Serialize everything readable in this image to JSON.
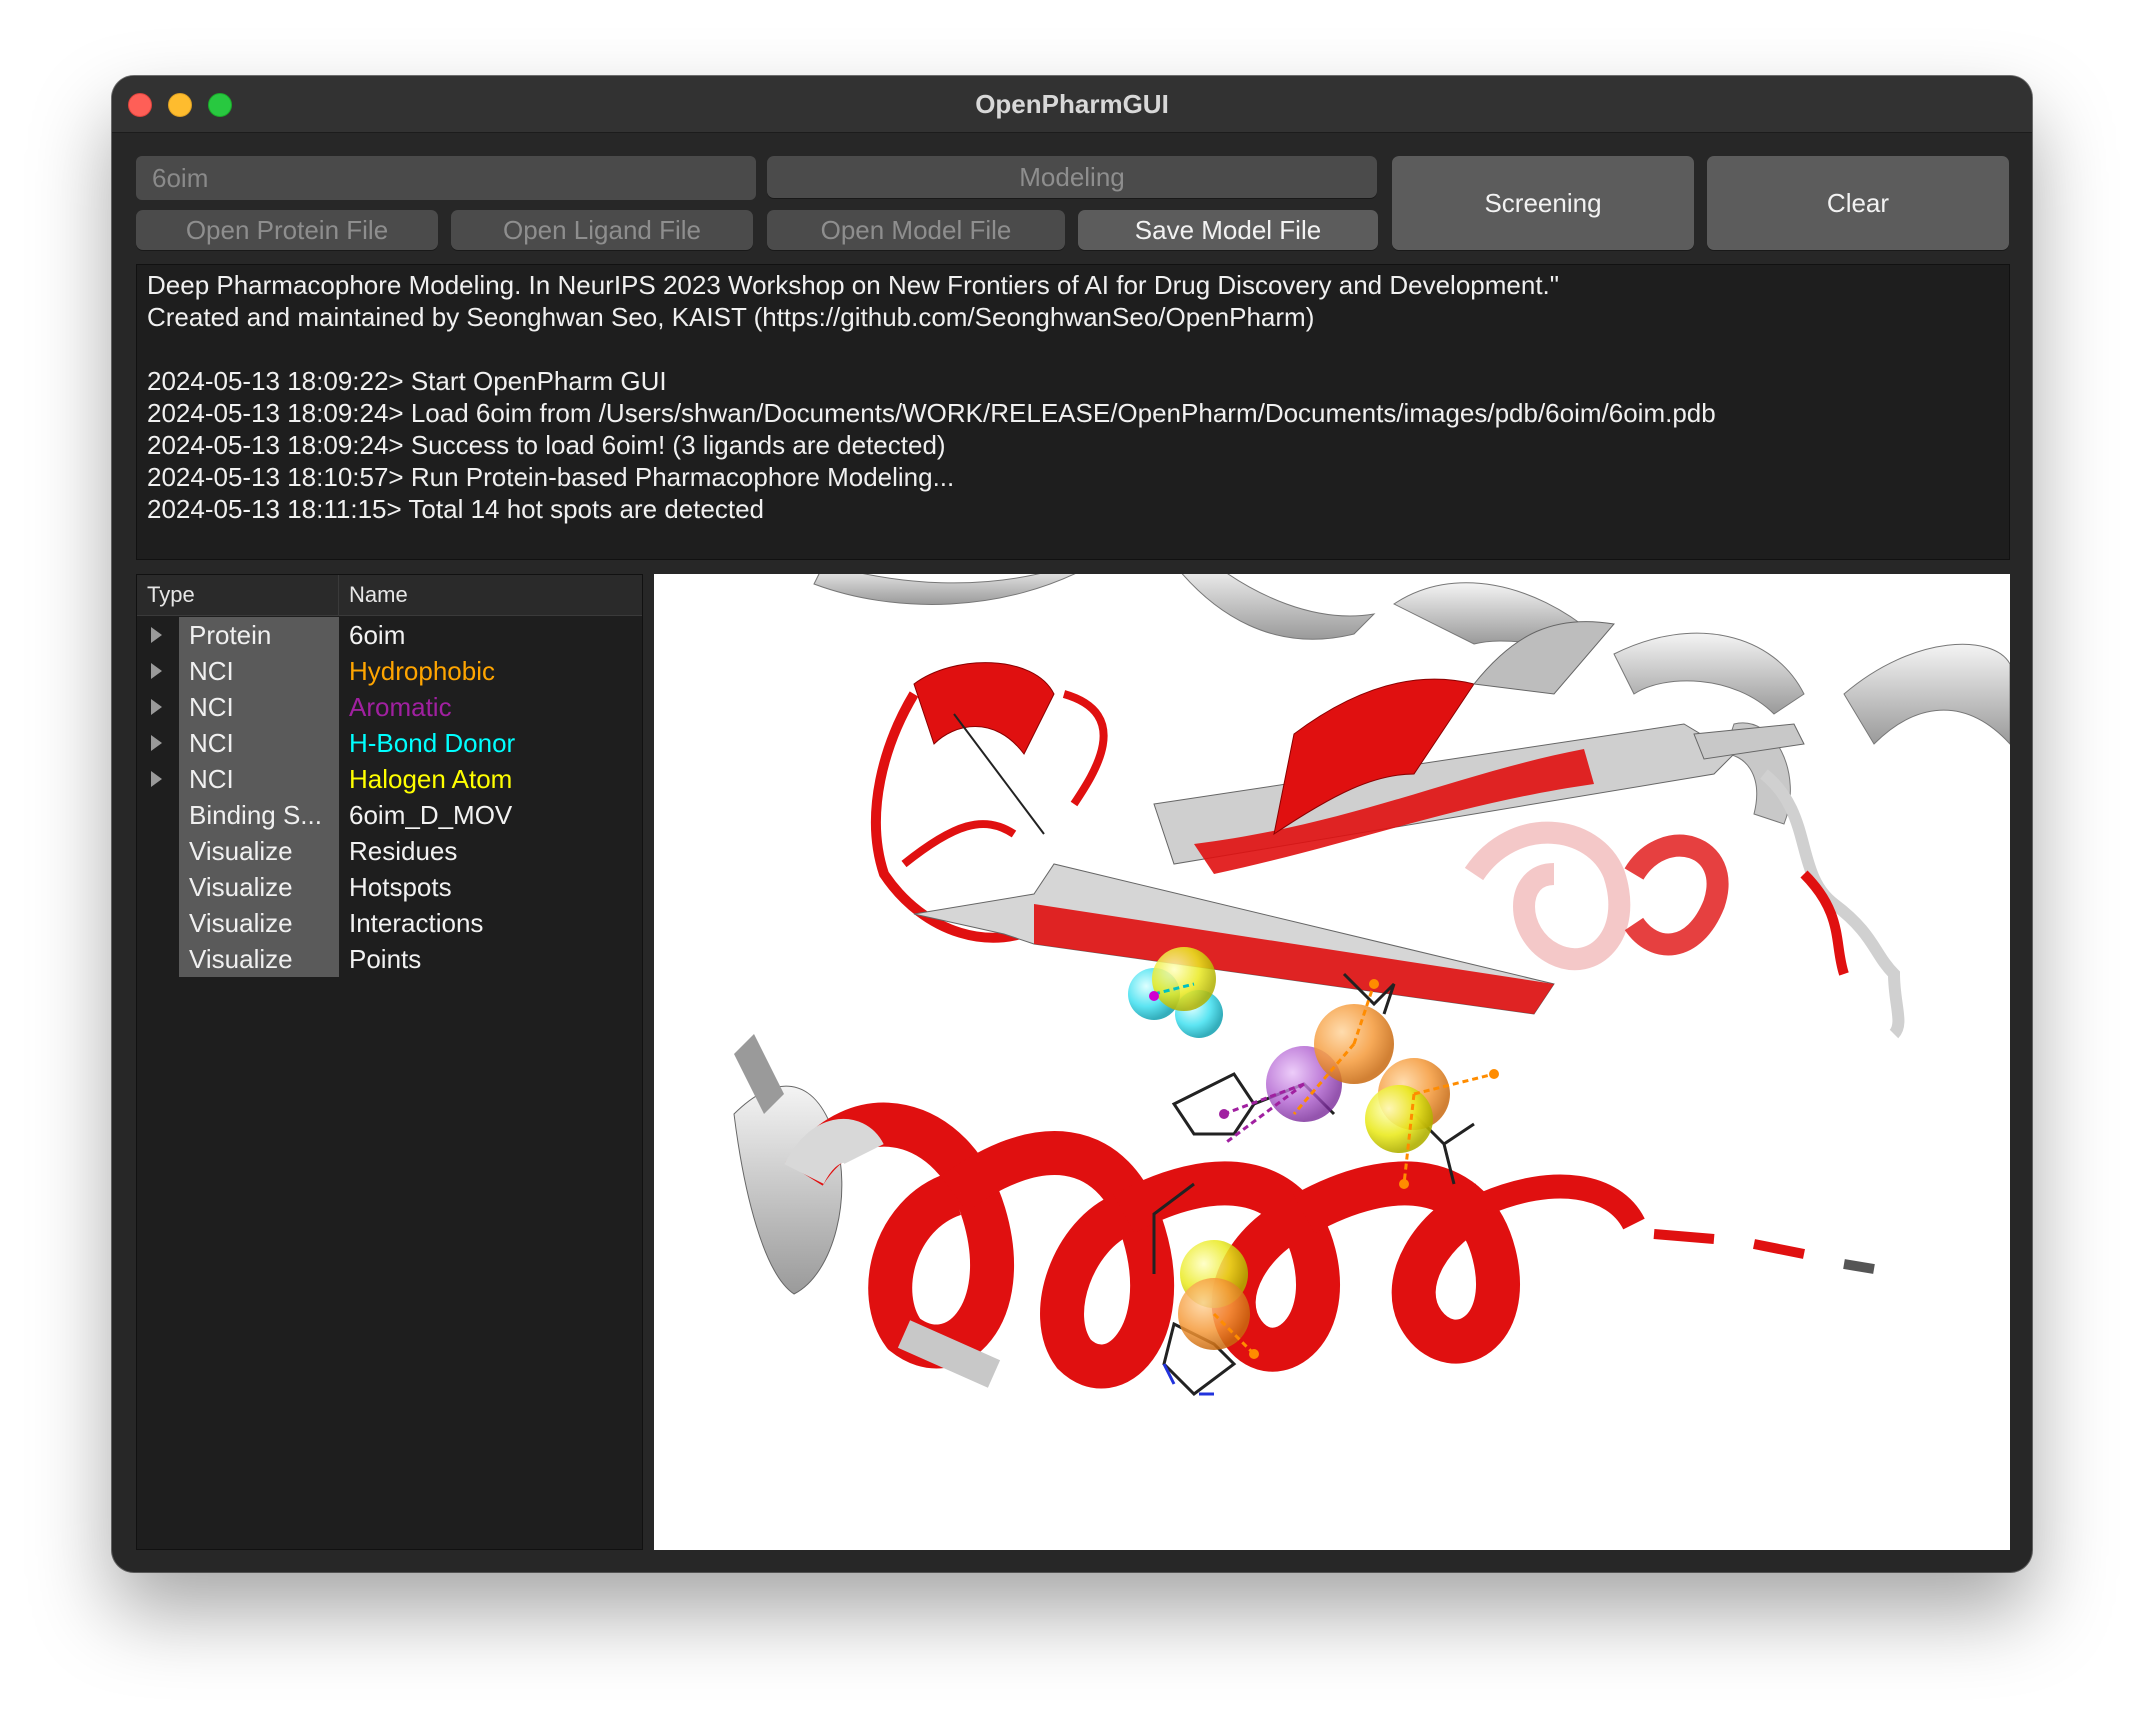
{
  "window": {
    "title": "OpenPharmGUI"
  },
  "toolbar": {
    "pdb_id_value": "6oim",
    "modeling_label": "Modeling",
    "open_protein_label": "Open Protein File",
    "open_ligand_label": "Open Ligand File",
    "open_model_label": "Open Model File",
    "save_model_label": "Save Model File",
    "screening_label": "Screening",
    "clear_label": "Clear"
  },
  "log": {
    "lines": [
      "Deep Pharmacophore Modeling. In NeurIPS 2023 Workshop on New Frontiers of AI for Drug Discovery and Development.\"",
      "Created and maintained by Seonghwan Seo, KAIST (https://github.com/SeonghwanSeo/OpenPharm)",
      "",
      "2024-05-13 18:09:22> Start OpenPharm GUI",
      "2024-05-13 18:09:24> Load 6oim from /Users/shwan/Documents/WORK/RELEASE/OpenPharm/Documents/images/pdb/6oim/6oim.pdb",
      "2024-05-13 18:09:24> Success to load 6oim! (3 ligands are detected)",
      "2024-05-13 18:10:57> Run Protein-based Pharmacophore Modeling...",
      "2024-05-13 18:11:15> Total 14 hot spots are detected"
    ]
  },
  "tree": {
    "headers": {
      "type": "Type",
      "name": "Name"
    },
    "rows": [
      {
        "type": "Protein",
        "name": "6oim",
        "expandable": true,
        "color": "#f2f2f2"
      },
      {
        "type": "NCI",
        "name": "Hydrophobic",
        "expandable": true,
        "color": "#ffa500"
      },
      {
        "type": "NCI",
        "name": "Aromatic",
        "expandable": true,
        "color": "#a020a0"
      },
      {
        "type": "NCI",
        "name": "H-Bond Donor",
        "expandable": true,
        "color": "#00ffff"
      },
      {
        "type": "NCI",
        "name": "Halogen Atom",
        "expandable": true,
        "color": "#ffff00"
      },
      {
        "type": "Binding S...",
        "name": "6oim_D_MOV",
        "expandable": false,
        "color": "#f2f2f2"
      },
      {
        "type": "Visualize",
        "name": "Residues",
        "expandable": false,
        "color": "#f2f2f2"
      },
      {
        "type": "Visualize",
        "name": "Hotspots",
        "expandable": false,
        "color": "#f2f2f2"
      },
      {
        "type": "Visualize",
        "name": "Interactions",
        "expandable": false,
        "color": "#f2f2f2"
      },
      {
        "type": "Visualize",
        "name": "Points",
        "expandable": false,
        "color": "#f2f2f2"
      }
    ]
  },
  "viewer": {
    "colors": {
      "ribbon_red": "#e01010",
      "ribbon_white": "#d9d9d9",
      "hydrophobic": "#f59a3a",
      "aromatic": "#b060d0",
      "hbond_donor": "#40e0f0",
      "halogen": "#eaea20"
    }
  }
}
